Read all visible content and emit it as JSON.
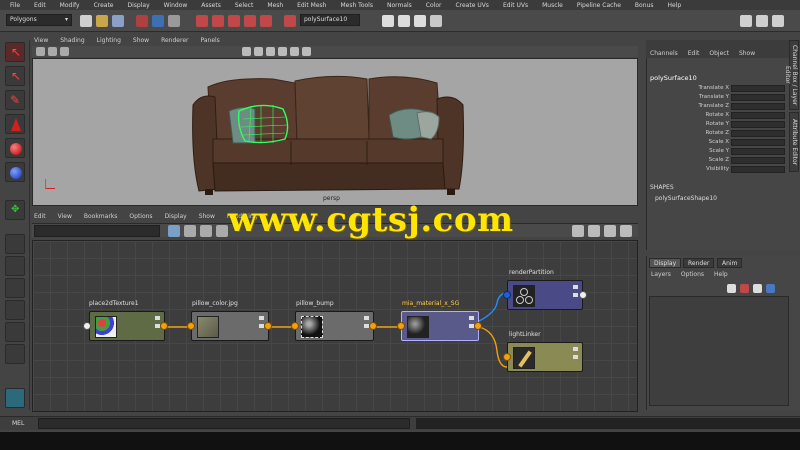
{
  "menubar": {
    "items": [
      "File",
      "Edit",
      "Modify",
      "Create",
      "Display",
      "Window",
      "Assets",
      "Select",
      "Mesh",
      "Edit Mesh",
      "Mesh Tools",
      "Normals",
      "Color",
      "Create UVs",
      "Edit UVs",
      "Muscle",
      "Pipeline Cache",
      "Bonus",
      "Help"
    ]
  },
  "shelf": {
    "mode_selector": "Polygons",
    "name_field": "polySurface10"
  },
  "viewport": {
    "menu": [
      "View",
      "Shading",
      "Lighting",
      "Show",
      "Renderer",
      "Panels"
    ],
    "camera_label": "persp"
  },
  "channel_box": {
    "tabs": [
      "Channels",
      "Edit",
      "Object",
      "Show"
    ],
    "object_name": "polySurface10",
    "attributes": [
      "Translate X",
      "Translate Y",
      "Translate Z",
      "Rotate X",
      "Rotate Y",
      "Rotate Z",
      "Scale X",
      "Scale Y",
      "Scale Z",
      "Visibility"
    ],
    "shapes_header": "SHAPES",
    "shape_name": "polySurfaceShape10"
  },
  "side_tabs": [
    "Channel Box / Layer Editor",
    "Attribute Editor"
  ],
  "layer_editor": {
    "tabs": [
      "Display",
      "Render",
      "Anim"
    ],
    "menu": [
      "Layers",
      "Options",
      "Help"
    ]
  },
  "hypershade": {
    "menu": [
      "Edit",
      "View",
      "Bookmarks",
      "Options",
      "Display",
      "Show",
      "Rendering"
    ],
    "nodes": [
      {
        "label": "place2dTexture1",
        "color": "#5f6b45",
        "swatch": "texture-icon"
      },
      {
        "label": "pillow_color.jpg",
        "color": "#6b6b6b",
        "swatch": "file-texture-icon"
      },
      {
        "label": "pillow_bump",
        "color": "#6b6b6b",
        "swatch": "bump-icon"
      },
      {
        "label": "mia_material_x_SG",
        "color": "#5a5a8a",
        "swatch": "material-icon"
      },
      {
        "label": "renderPartition",
        "color": "#4a4a86",
        "swatch": "partition-icon"
      },
      {
        "label": "lightLinker",
        "color": "#8a8a55",
        "swatch": "light-linker-icon"
      }
    ]
  },
  "watermark": "www.cgtsj.com",
  "cmdline": {
    "label": "MEL"
  },
  "colors": {
    "background": "#444444",
    "viewport": "#a5a5a5",
    "connection": "#f0a010",
    "selection": "#1e90ff",
    "watermark": "#ffe500"
  }
}
